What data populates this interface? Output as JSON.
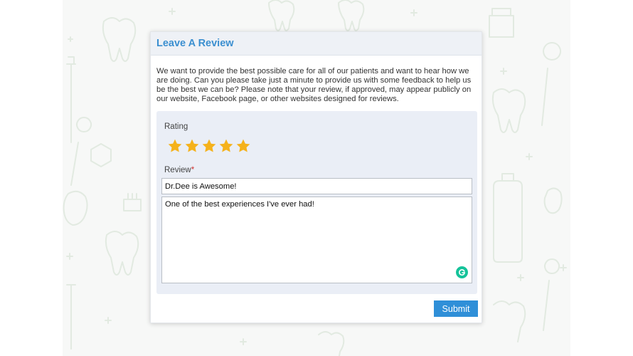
{
  "colors": {
    "accent": "#3b8fd0",
    "star": "#f5b21b",
    "submit_bg": "#2f8fd8",
    "required": "#d0312d",
    "grammarly": "#15c39a",
    "pattern": "#e4ebe3"
  },
  "review_form": {
    "title": "Leave A Review",
    "intro": "We want to provide the best possible care for all of our patients and want to hear how we are doing. Can you please take just a minute to provide us with some feedback to help us be the best we can be? Please note that your review, if approved, may appear publicly on our website, Facebook page, or other websites designed for reviews.",
    "rating_label": "Rating",
    "rating": 5,
    "rating_max": 5,
    "star_icon": "star-icon",
    "review_label": "Review",
    "required_mark": "*",
    "review_title_value": "Dr.Dee is Awesome!",
    "review_body_value": "One of the best experiences I've ever had!",
    "grammarly_icon": "grammarly-icon",
    "submit_label": "Submit"
  },
  "background": {
    "pattern_icons": [
      "tooth-icon",
      "toothbrush-icon",
      "mouthwash-icon",
      "dental-mirror-icon",
      "plus-icon"
    ]
  }
}
